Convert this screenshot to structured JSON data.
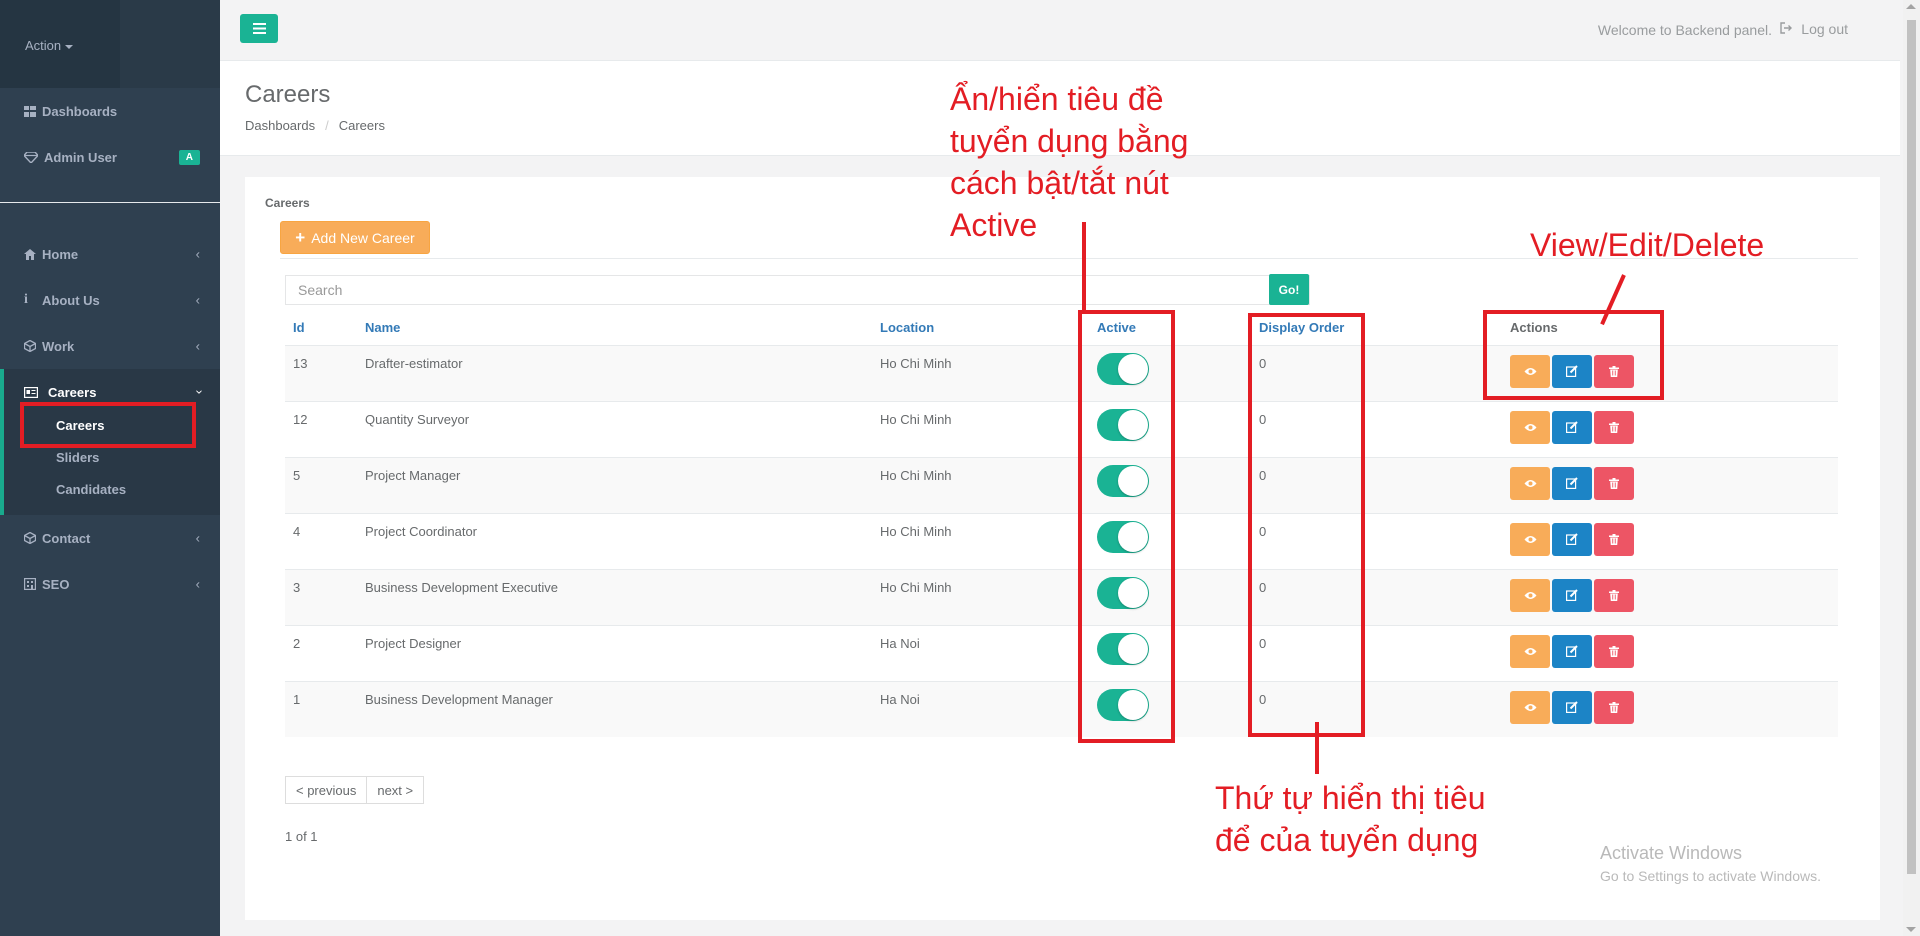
{
  "sidebar": {
    "header_label": "Action",
    "top_items": [
      {
        "label": "Dashboards",
        "icon": "dashboard-grid-icon"
      },
      {
        "label": "Admin User",
        "icon": "diamond-icon",
        "badge": "A"
      }
    ],
    "menu": [
      {
        "label": "Home",
        "icon": "home-icon"
      },
      {
        "label": "About Us",
        "icon": "info-icon"
      },
      {
        "label": "Work",
        "icon": "cube-icon"
      }
    ],
    "careers": {
      "label": "Careers",
      "icon": "id-card-icon",
      "sub": [
        "Careers",
        "Sliders",
        "Candidates"
      ]
    },
    "menu_after": [
      {
        "label": "Contact",
        "icon": "cube-icon"
      },
      {
        "label": "SEO",
        "icon": "building-icon"
      }
    ]
  },
  "topbar": {
    "welcome": "Welcome to Backend panel.",
    "logout": "Log out"
  },
  "heading": {
    "title": "Careers",
    "breadcrumb": [
      "Dashboards",
      "Careers"
    ]
  },
  "card": {
    "title": "Careers",
    "add_button": "Add New Career",
    "search_placeholder": "Search",
    "go_button": "Go!"
  },
  "table": {
    "headers": [
      "Id",
      "Name",
      "Location",
      "Active",
      "Display Order",
      "Actions"
    ],
    "rows": [
      {
        "id": "13",
        "name": "Drafter-estimator",
        "location": "Ho Chi Minh",
        "active": true,
        "order": "0"
      },
      {
        "id": "12",
        "name": "Quantity Surveyor",
        "location": "Ho Chi Minh",
        "active": true,
        "order": "0"
      },
      {
        "id": "5",
        "name": "Project Manager",
        "location": "Ho Chi Minh",
        "active": true,
        "order": "0"
      },
      {
        "id": "4",
        "name": "Project Coordinator",
        "location": "Ho Chi Minh",
        "active": true,
        "order": "0"
      },
      {
        "id": "3",
        "name": "Business Development Executive",
        "location": "Ho Chi Minh",
        "active": true,
        "order": "0"
      },
      {
        "id": "2",
        "name": "Project Designer",
        "location": "Ha Noi",
        "active": true,
        "order": "0"
      },
      {
        "id": "1",
        "name": "Business Development Manager",
        "location": "Ha Noi",
        "active": true,
        "order": "0"
      }
    ]
  },
  "pagination": {
    "previous": "< previous",
    "next": "next >",
    "info": "1 of 1"
  },
  "watermark": {
    "line1": "Activate Windows",
    "line2": "Go to Settings to activate Windows."
  },
  "annotations": {
    "active_note": [
      "Ẩn/hiển tiêu đề",
      "tuyển dụng bằng",
      "cách bật/tắt nút",
      "Active"
    ],
    "actions_note": "View/Edit/Delete",
    "order_note": [
      "Thứ tự hiển thị tiêu",
      "để của tuyển dụng"
    ]
  },
  "colors": {
    "sidebar": "#2f4050",
    "primary": "#1ab394",
    "warning": "#f8ac59",
    "info": "#1c84c6",
    "danger": "#ed5565",
    "annotation": "#e31d24"
  }
}
